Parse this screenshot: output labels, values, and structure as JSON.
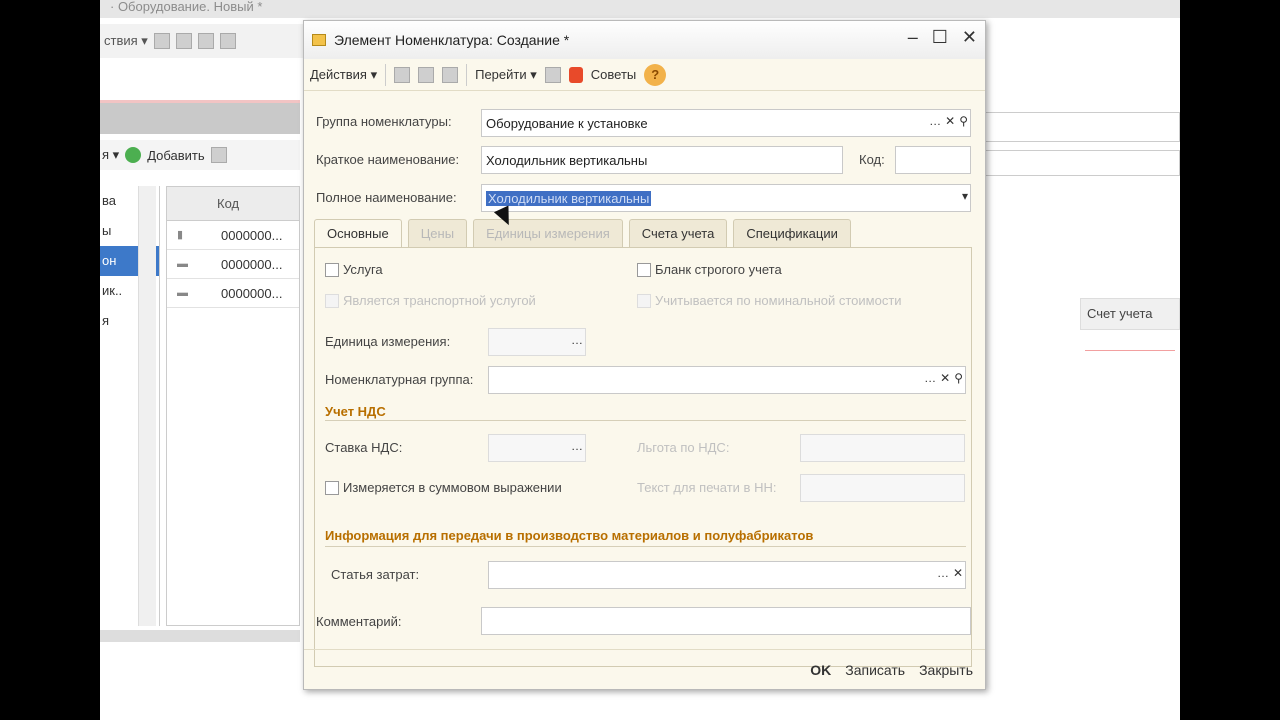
{
  "background": {
    "title": "· Оборудование. Новый *",
    "toolbar_actions": "ствия ▾",
    "toolbar2_actions": "я ▾",
    "add_button": "Добавить",
    "table_header": "Код",
    "rows": [
      "0000000...",
      "0000000...",
      "0000000..."
    ],
    "list_items": [
      "ва",
      "ы",
      "он",
      "ик..",
      "я"
    ],
    "right_header": "Счет учета"
  },
  "dialog": {
    "title": "Элемент Номенклатура: Создание *",
    "toolbar": {
      "actions": "Действия ▾",
      "goto": "Перейти ▾",
      "tips": "Советы"
    },
    "group_label": "Группа номенклатуры:",
    "group_value": "Оборудование к установке",
    "short_label": "Краткое наименование:",
    "short_value": "Холодильник вертикальны",
    "code_label": "Код:",
    "code_value": "",
    "full_label": "Полное наименование:",
    "full_value": "Холодильник вертикальны",
    "tabs": [
      "Основные",
      "Цены",
      "Единицы измерения",
      "Счета учета",
      "Спецификации"
    ],
    "service_label": "Услуга",
    "strict_label": "Бланк строгого учета",
    "transport_label": "Является транспортной услугой",
    "nominal_label": "Учитывается по номинальной стоимости",
    "unit_label": "Единица измерения:",
    "nomgroup_label": "Номенклатурная группа:",
    "vat_section": "Учет НДС",
    "vat_rate_label": "Ставка НДС:",
    "vat_benefit_label": "Льгота по НДС:",
    "sum_label": "Измеряется в суммовом выражении",
    "print_label": "Текст для печати в НН:",
    "info_section": "Информация для передачи в производство материалов и полуфабрикатов",
    "cost_label": "Статья затрат:",
    "comment_label": "Комментарий:",
    "ok": "OK",
    "save": "Записать",
    "close": "Закрыть"
  }
}
